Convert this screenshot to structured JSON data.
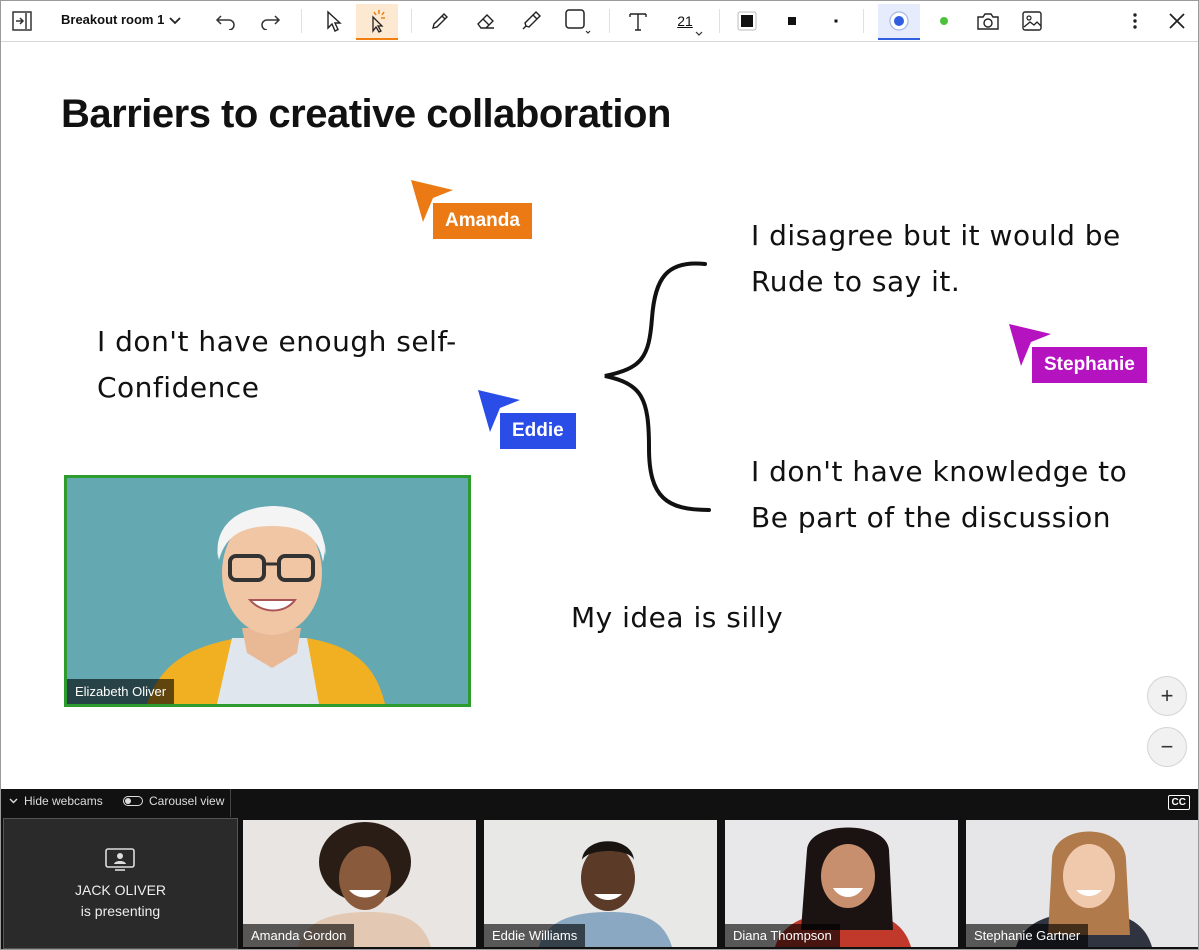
{
  "toolbar": {
    "room_name": "Breakout room 1",
    "font_size": "21",
    "icons": [
      "exit-panel-icon",
      "chevron-down-icon",
      "undo-icon",
      "redo-icon",
      "select-pointer-icon",
      "laser-pointer-icon",
      "pencil-icon",
      "eraser-icon",
      "highlighter-icon",
      "shape-square-icon",
      "text-icon",
      "color-swatch-icon",
      "stroke-thick-icon",
      "stroke-thin-icon",
      "record-icon",
      "live-dot-icon",
      "camera-icon",
      "image-icon",
      "more-vertical-icon",
      "close-icon"
    ],
    "accent_orange": "#f07f10",
    "accent_blue": "#2f5fe0"
  },
  "canvas": {
    "title": "Barriers to creative collaboration",
    "notes": {
      "self_confidence_line1": "I don't have enough self-",
      "self_confidence_line2": "Confidence",
      "disagree_line1": "I disagree but it would be",
      "disagree_line2": "Rude to say it.",
      "knowledge_line1": "I don't have knowledge to",
      "knowledge_line2": "Be part of the discussion",
      "silly": "My idea is silly"
    },
    "cursors": [
      {
        "name": "Amanda",
        "color": "#ec7a14"
      },
      {
        "name": "Eddie",
        "color": "#2a4de8"
      },
      {
        "name": "Stephanie",
        "color": "#b512c0"
      }
    ],
    "video": {
      "name": "Elizabeth Oliver",
      "border_color": "#2e9b2e"
    },
    "zoom_in": "+",
    "zoom_out": "−"
  },
  "webcams": {
    "hide_label": "Hide webcams",
    "carousel_label": "Carousel view",
    "cc_label": "CC",
    "presenter_name": "JACK OLIVER",
    "presenter_status": "is presenting",
    "tiles": [
      {
        "name": "Amanda Gordon"
      },
      {
        "name": "Eddie Williams"
      },
      {
        "name": "Diana Thompson"
      },
      {
        "name": "Stephanie Gartner"
      }
    ]
  }
}
